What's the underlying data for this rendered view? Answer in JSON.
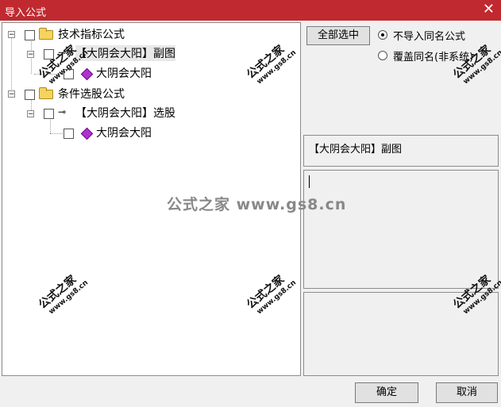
{
  "window": {
    "title": "导入公式",
    "close_glyph": "✕"
  },
  "tree": {
    "groups": [
      {
        "label": "技术指标公式",
        "formula": {
          "label": "【大阴会大阳】副图",
          "child": "大阴会大阳"
        }
      },
      {
        "label": "条件选股公式",
        "formula": {
          "label": "【大阴会大阳】选股",
          "child": "大阴会大阳"
        }
      }
    ]
  },
  "controls": {
    "select_all_label": "全部选中",
    "radio_options": [
      {
        "label": "不导入同名公式",
        "selected": true
      },
      {
        "label": "覆盖同名(非系统)",
        "selected": false
      }
    ]
  },
  "info": {
    "selected_name": "【大阴会大阳】副图"
  },
  "footer": {
    "ok_label": "确定",
    "cancel_label": "取消"
  },
  "watermark": {
    "mark": "公式之家",
    "url": "www.gs8.cn",
    "center": "公式之家 www.gs8.cn"
  },
  "colors": {
    "titlebar": "#c0292f",
    "folder": "#f4d35e",
    "gem": "#b030d0"
  }
}
